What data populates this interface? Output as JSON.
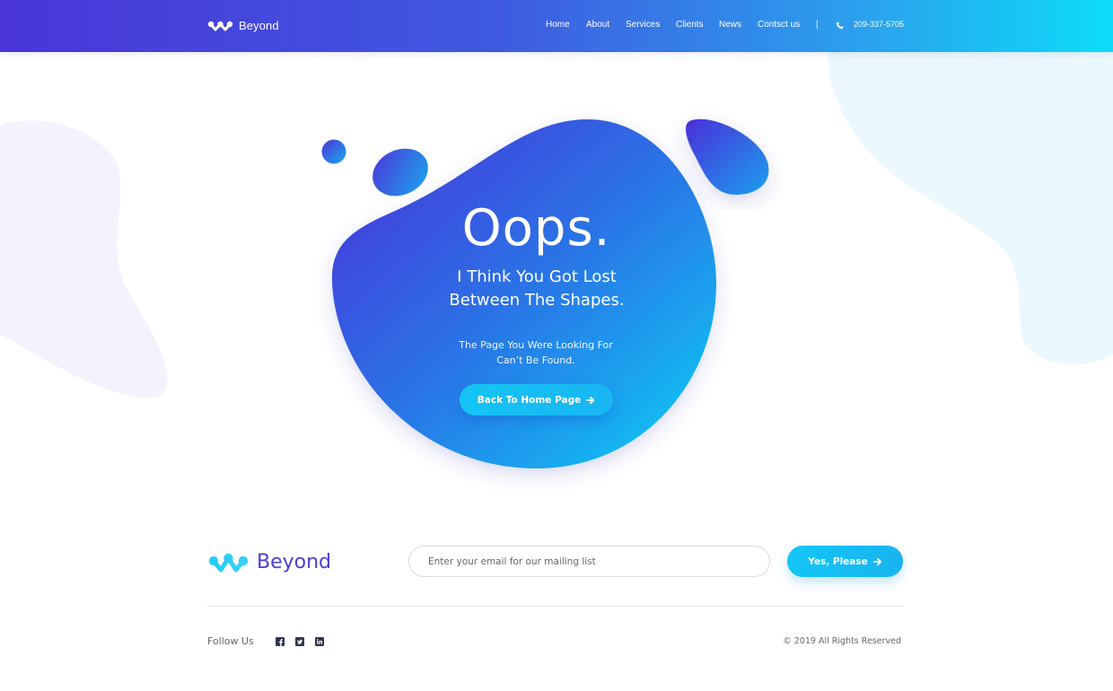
{
  "header": {
    "brand": "Beyond",
    "nav": [
      {
        "label": "Home"
      },
      {
        "label": "About"
      },
      {
        "label": "Services"
      },
      {
        "label": "Clients"
      },
      {
        "label": "News"
      },
      {
        "label": "Contsct us"
      }
    ],
    "separator": "|",
    "phone": "209-337-5705",
    "phone_icon": "phone-icon"
  },
  "hero": {
    "heading": "Oops.",
    "subtitle_line1": "I Think You Got Lost",
    "subtitle_line2": "Between The Shapes.",
    "desc_line1": "The Page You Were Looking For",
    "desc_line2": "Can’t Be Found.",
    "button_label": "Back To Home Page",
    "button_icon": "arrow-right-icon"
  },
  "footer": {
    "brand": "Beyond",
    "email_placeholder": "Enter your email for our mailing list",
    "subscribe_label": "Yes, Please",
    "follow_label": "Follow Us",
    "social": [
      "facebook-icon",
      "twitter-icon",
      "linkedin-icon"
    ],
    "copyright": "© 2019 All Rights Reserved"
  },
  "colors": {
    "brand_purple": "#4a35d8",
    "brand_cyan": "#0ddcf8",
    "button_cyan": "#13c5f4",
    "footer_brand_text": "#4a3fd3"
  }
}
